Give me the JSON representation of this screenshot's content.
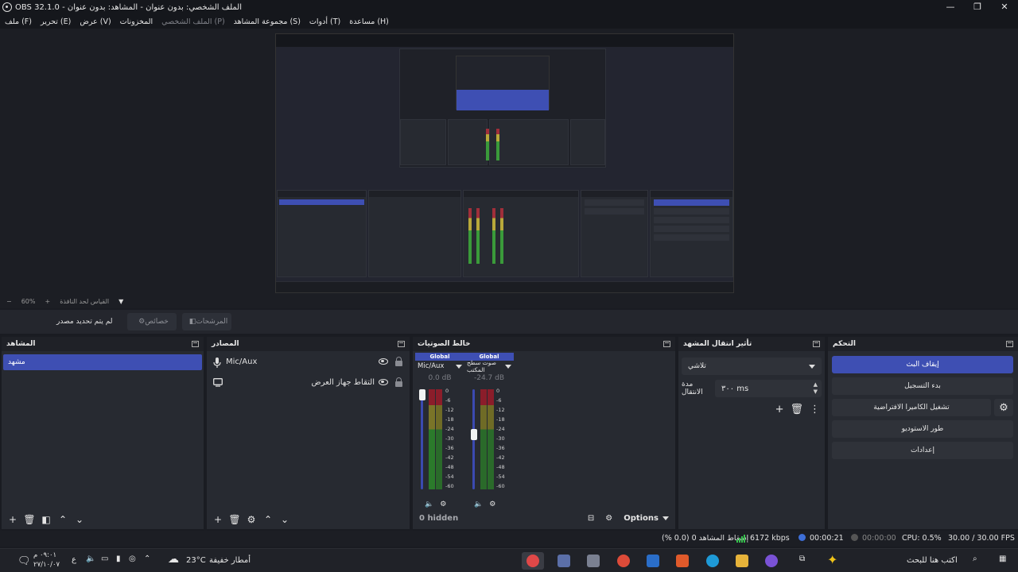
{
  "window": {
    "title": "OBS 32.1.0 - الملف الشخصي: بدون عنوان - المشاهد: بدون عنوان",
    "controls": [
      "—",
      "❐",
      "✕"
    ]
  },
  "menu": {
    "items": [
      "ملف (F)",
      "تحرير (E)",
      "عرض (V)",
      "المخزونات",
      "الملف الشخصي (P)",
      "مجموعة المشاهد (S)",
      "أدوات (T)",
      "مساعدة (H)"
    ]
  },
  "zoom": {
    "minus": "−",
    "value": "60%",
    "plus": "+",
    "mode": "القياس لحد النافذة"
  },
  "context_bar": {
    "no_source": "لم يتم تحديد مصدر",
    "properties": "خصائص",
    "filters": "المرشحات"
  },
  "scenes": {
    "title": "المشاهد",
    "items": [
      "مشهد"
    ]
  },
  "sources": {
    "title": "المصادر",
    "items": [
      {
        "name": "Mic/Aux",
        "icon": "microphone-icon"
      },
      {
        "name": "التقاط جهاز العرض",
        "icon": "monitor-icon"
      }
    ]
  },
  "mixer": {
    "title": "خالط الصوتيات",
    "channels": [
      {
        "global": "Global",
        "name": "Mic/Aux",
        "db": "0.0 dB",
        "fader_level": 1.0
      },
      {
        "global": "Global",
        "name": "صوت سطح المكتب",
        "db": "-24.7 dB",
        "fader_level": 0.55
      }
    ],
    "scale": [
      "0",
      "-6",
      "-12",
      "-18",
      "-24",
      "-30",
      "-36",
      "-42",
      "-48",
      "-54",
      "-60"
    ],
    "hidden": "0 hidden",
    "options": "Options"
  },
  "transitions": {
    "title": "تأثير انتقال المشهد",
    "selected": "تلاشي",
    "duration_label": "مدة الانتقال",
    "duration_value": "٣٠٠ ms"
  },
  "controls": {
    "title": "التحكم",
    "stop_stream": "إيقاف البث",
    "start_recording": "بدء التسجيل",
    "virtual_camera": "تشغيل الكاميرا الافتراضية",
    "studio_mode": "طور الاستوديو",
    "settings": "إعدادات"
  },
  "status": {
    "dropped": "إسقاط المشاهد 0 (0.0 %)",
    "bitrate": "6172 kbps",
    "stream_time": "00:00:21",
    "rec_time": "00:00:00",
    "cpu": "CPU: 0.5%",
    "fps": "30.00 / 30.00 FPS"
  },
  "taskbar": {
    "weather_temp": "23°C",
    "weather_desc": "أمطار خفيفة",
    "search_placeholder": "اكتب هنا للبحث",
    "time": "٠٩:٠١ م",
    "date": "٢٧/١٠/٠٧",
    "lang": "ع"
  },
  "colors": {
    "accent": "#3e4fb3",
    "dock_bg": "#272a31",
    "bg": "#1c1e24",
    "stream_green": "#36c04d"
  }
}
